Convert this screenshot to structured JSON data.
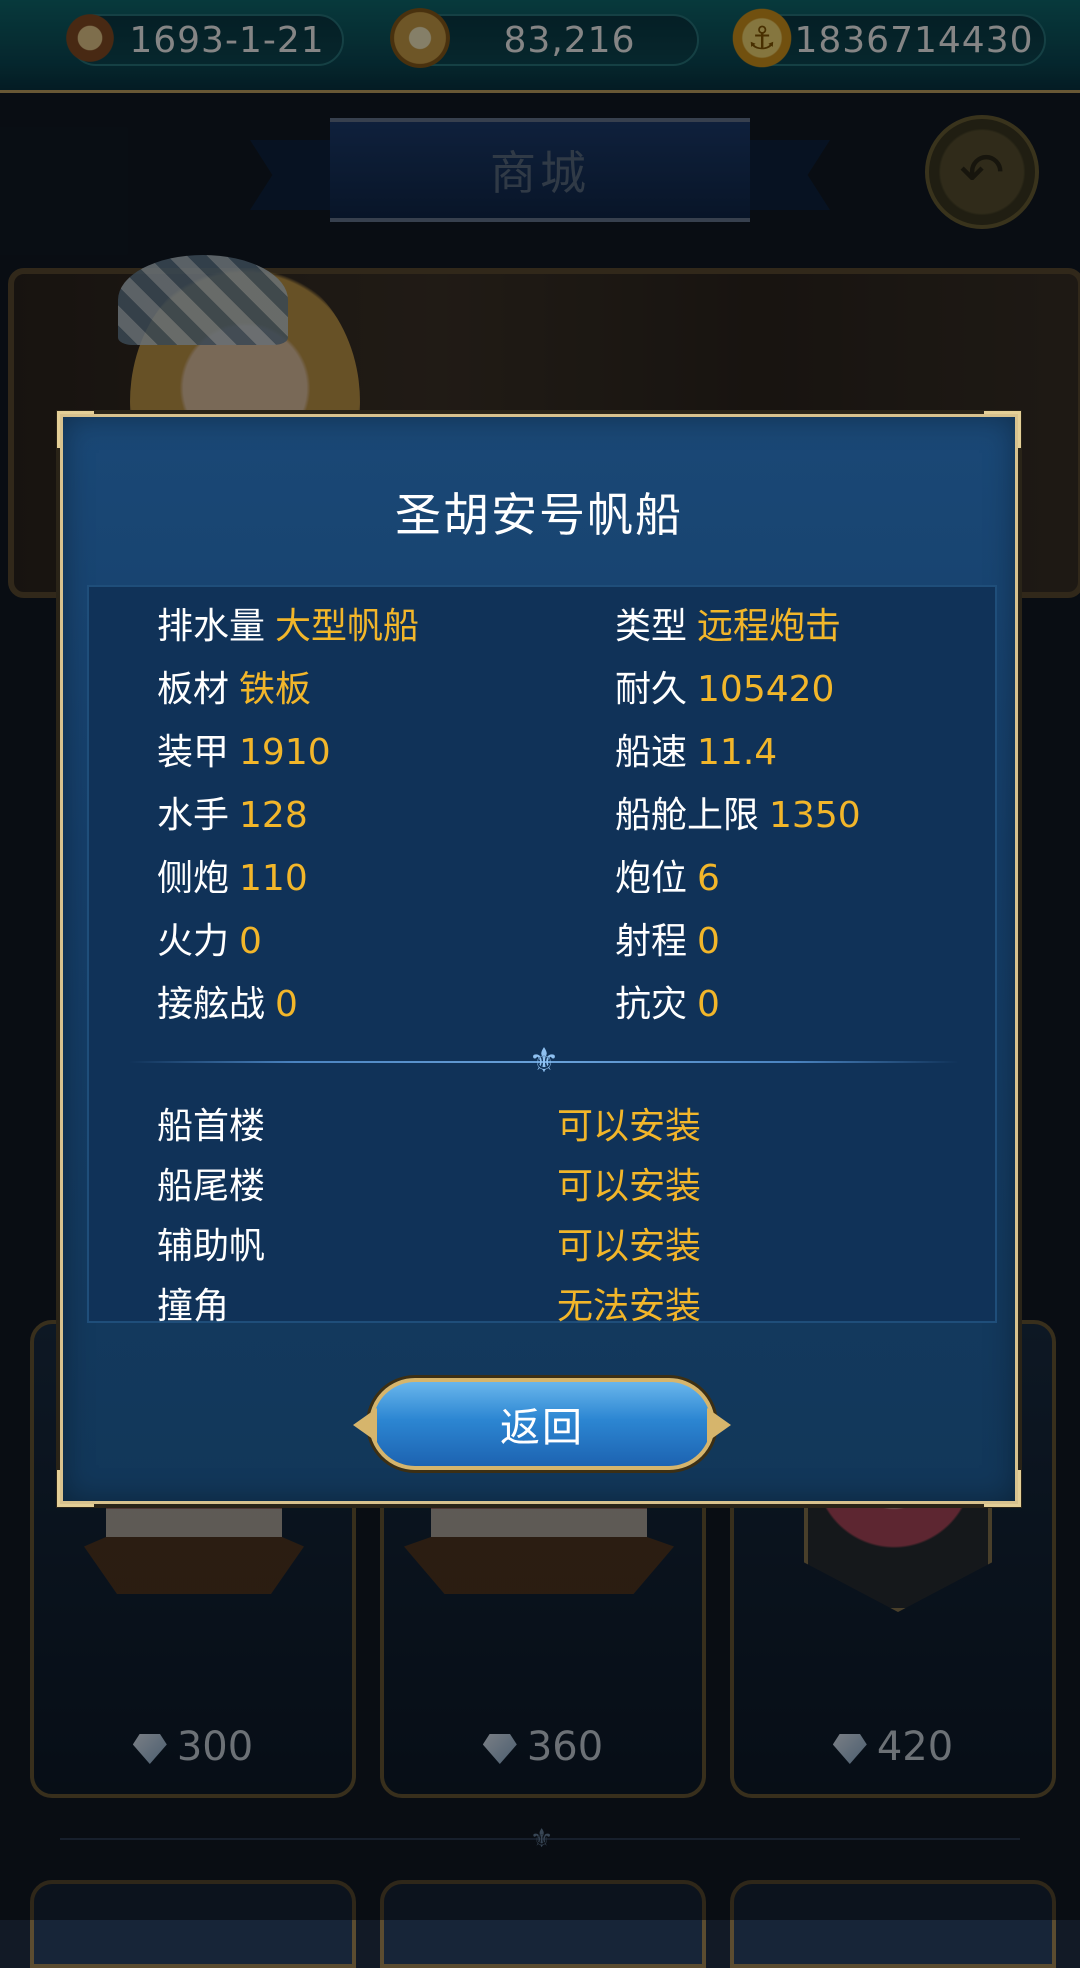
{
  "status_bar": {
    "date": "1693-1-21",
    "compass_value": "83,216",
    "gold": "1836714430"
  },
  "shop": {
    "title": "商城",
    "prices": [
      "300",
      "360",
      "420"
    ]
  },
  "dialog": {
    "title": "圣胡安号帆船",
    "stats_left": [
      {
        "label": "排水量",
        "value": "大型帆船"
      },
      {
        "label": "板材",
        "value": "铁板"
      },
      {
        "label": "装甲",
        "value": "1910"
      },
      {
        "label": "水手",
        "value": "128"
      },
      {
        "label": "侧炮",
        "value": "110"
      },
      {
        "label": "火力",
        "value": "0"
      },
      {
        "label": "接舷战",
        "value": "0"
      }
    ],
    "stats_right": [
      {
        "label": "类型",
        "value": "远程炮击"
      },
      {
        "label": "耐久",
        "value": "105420"
      },
      {
        "label": "船速",
        "value": "11.4"
      },
      {
        "label": "船舱上限",
        "value": "1350"
      },
      {
        "label": "炮位",
        "value": "6"
      },
      {
        "label": "射程",
        "value": "0"
      },
      {
        "label": "抗灾",
        "value": "0"
      }
    ],
    "slots": [
      {
        "label": "船首楼",
        "value": "可以安装"
      },
      {
        "label": "船尾楼",
        "value": "可以安装"
      },
      {
        "label": "辅助帆",
        "value": "可以安装"
      },
      {
        "label": "撞角",
        "value": "无法安装"
      }
    ],
    "return_label": "返回"
  },
  "colors": {
    "accent_gold": "#f2b62a",
    "dialog_bg": "#153e69",
    "border_gold": "#d8c28e"
  }
}
